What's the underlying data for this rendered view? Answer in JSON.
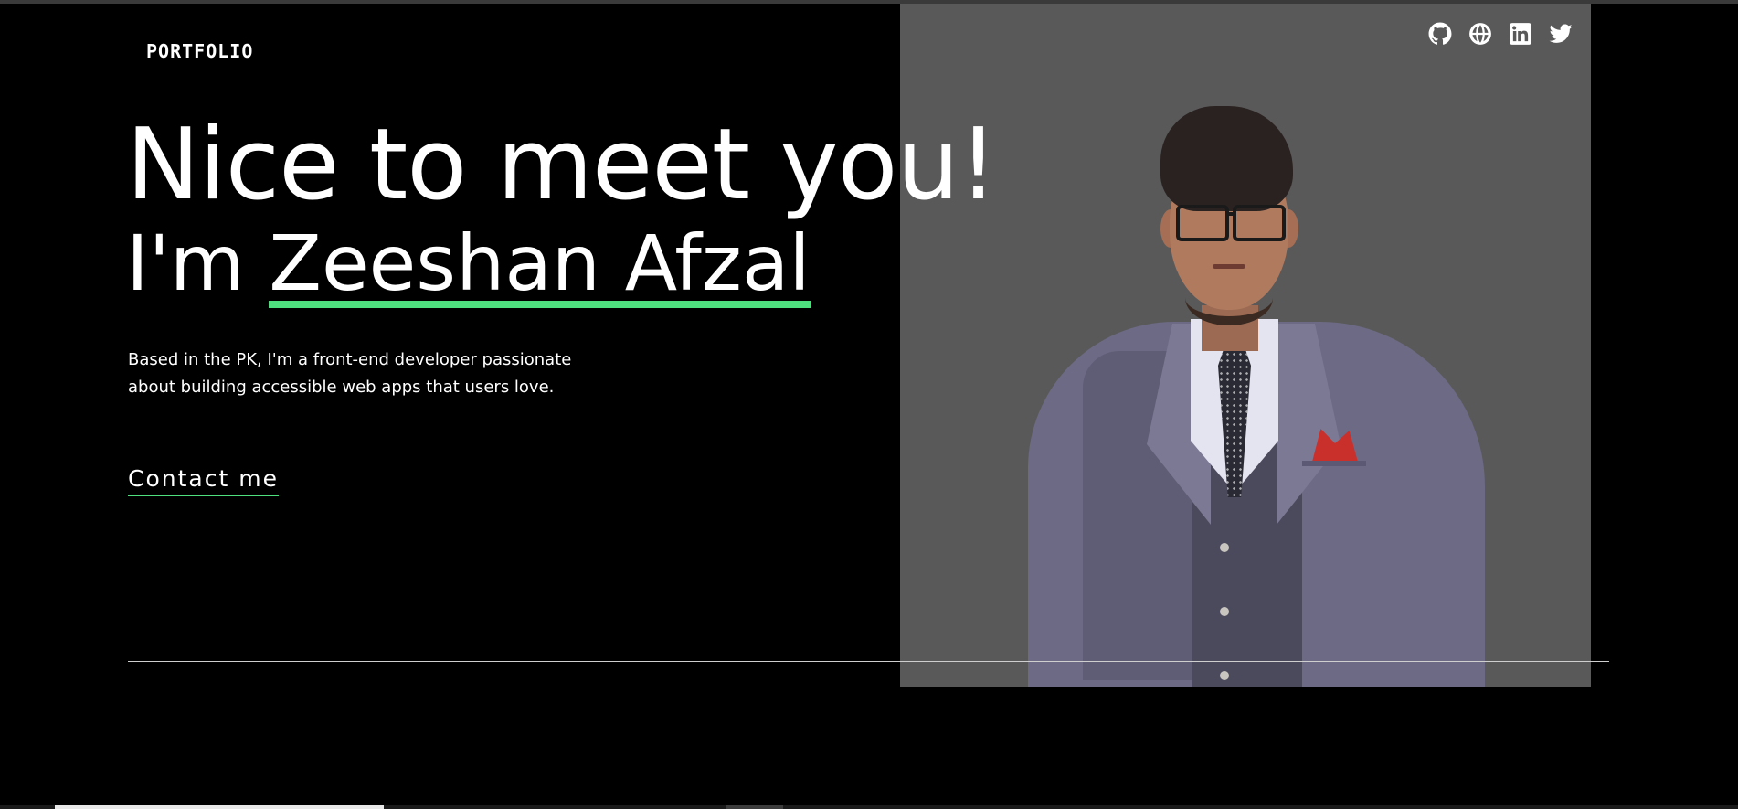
{
  "nav": {
    "brand": "PORTFOLIO",
    "socials": [
      {
        "name": "GitHub",
        "icon": "github-icon"
      },
      {
        "name": "Website",
        "icon": "globe-icon"
      },
      {
        "name": "LinkedIn",
        "icon": "linkedin-icon"
      },
      {
        "name": "Twitter",
        "icon": "twitter-icon"
      }
    ]
  },
  "hero": {
    "greeting": "Nice to meet you!",
    "intro_prefix": "I'm ",
    "name": "Zeeshan Afzal",
    "bio": "Based in the PK, I'm a front-end developer passionate about building accessible web apps that users love.",
    "cta_label": "Contact me"
  },
  "colors": {
    "background": "#000000",
    "accent": "#4ee07f",
    "photo_panel": "#595959",
    "text": "#ffffff"
  }
}
